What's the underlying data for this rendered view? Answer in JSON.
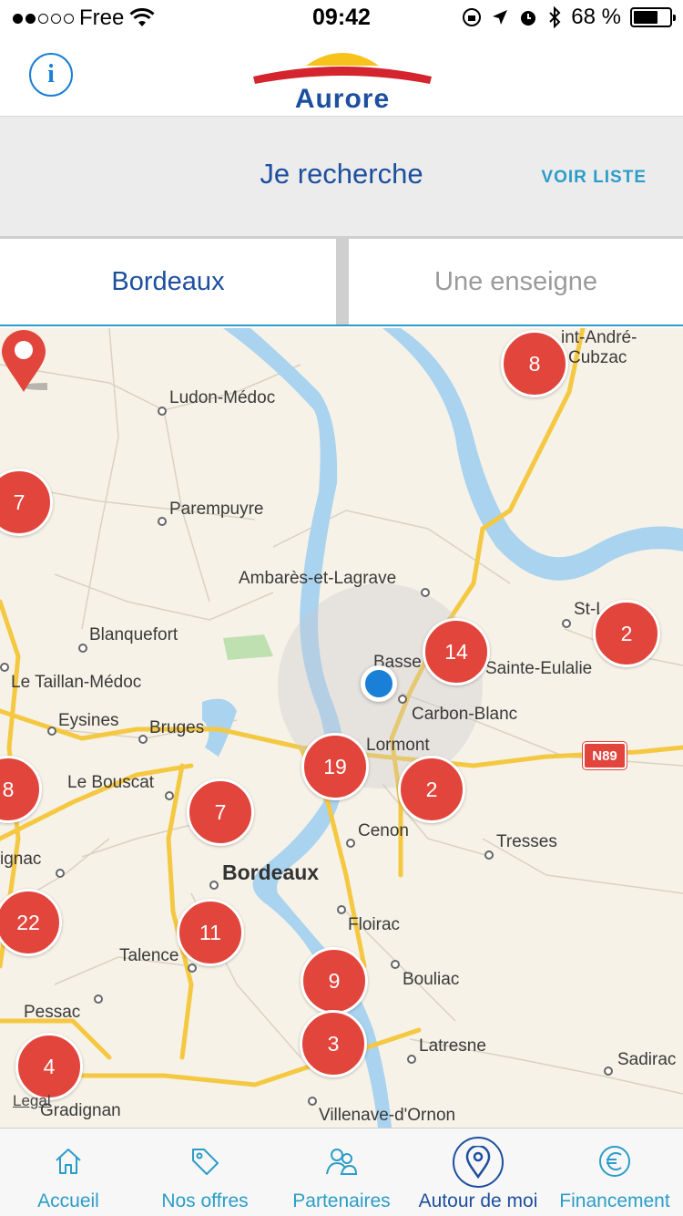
{
  "status": {
    "carrier": "Free",
    "time": "09:42",
    "battery": "68 %",
    "battery_level": 0.68
  },
  "header": {
    "info_icon": "i",
    "logo_text": "Aurore"
  },
  "search": {
    "title": "Je recherche",
    "voir_liste": "VOIR LISTE"
  },
  "segments": {
    "city": "Bordeaux",
    "enseigne_placeholder": "Une enseigne"
  },
  "map": {
    "places": [
      "Ludon-Médoc",
      "Parempuyre",
      "Ambarès-et-Lagrave",
      "Blanquefort",
      "Le Taillan-Médoc",
      "Eysines",
      "Bruges",
      "Le Bouscat",
      "Bordeaux",
      "Cenon",
      "Floirac",
      "Tresses",
      "Carbon-Blanc",
      "Lormont",
      "Bouliac",
      "Latresne",
      "Talence",
      "Pessac",
      "Gradignan",
      "Villenave-d'Ornon",
      "Sadirac",
      "int-André-",
      "Cubzac",
      "Sainte-Eulalie",
      "St-L",
      "Basse",
      "ignac"
    ],
    "road_label": "N89",
    "legal": "Legal",
    "clusters": [
      "8",
      "7",
      "2",
      "14",
      "19",
      "2",
      "7",
      "8",
      "22",
      "11",
      "9",
      "3",
      "4"
    ]
  },
  "tabbar": {
    "tabs": [
      {
        "label": "Accueil",
        "icon": "home-icon"
      },
      {
        "label": "Nos offres",
        "icon": "tag-icon"
      },
      {
        "label": "Partenaires",
        "icon": "partners-icon"
      },
      {
        "label": "Autour de moi",
        "icon": "location-pin-icon"
      },
      {
        "label": "Financement",
        "icon": "euro-icon"
      }
    ],
    "active_index": 3
  },
  "colors": {
    "brand_blue": "#1d4f9f",
    "accent": "#2c9dc8",
    "cluster_red": "#e2453c",
    "water": "#a9d3ef",
    "road": "#f5c842"
  }
}
